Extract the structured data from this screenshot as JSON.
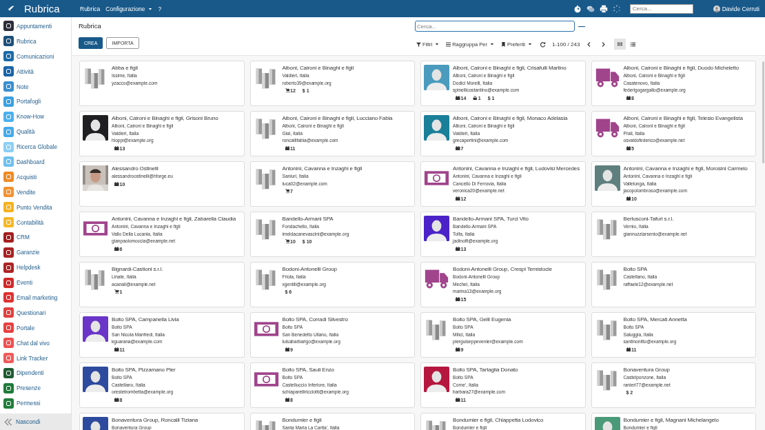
{
  "topbar": {
    "app_title": "Rubrica",
    "menu": [
      {
        "label": "Rubrica",
        "dropdown": false
      },
      {
        "label": "Configurazione",
        "dropdown": true
      },
      {
        "label": "?",
        "dropdown": false
      }
    ],
    "search": {
      "placeholder": "Cerca..."
    },
    "user": "Davide Cerruti"
  },
  "sidebar": {
    "items": [
      {
        "label": "Appuntamenti",
        "color": "#2b2d3a"
      },
      {
        "label": "Rubrica",
        "color": "#1d4f7a"
      },
      {
        "label": "Comunicazioni",
        "color": "#1a6aa8"
      },
      {
        "label": "Attività",
        "color": "#1a64a8"
      },
      {
        "label": "Note",
        "color": "#3a8fd0"
      },
      {
        "label": "Portafogli",
        "color": "#3aa0e0"
      },
      {
        "label": "Know-How",
        "color": "#4ab0ef"
      },
      {
        "label": "Qualità",
        "color": "#45aaea"
      },
      {
        "label": "Ricerca Globale",
        "color": "#8ccff5"
      },
      {
        "label": "Dashboard",
        "color": "#6fc0ef"
      },
      {
        "label": "Acquisti",
        "color": "#f08a24"
      },
      {
        "label": "Vendite",
        "color": "#f39230"
      },
      {
        "label": "Punto Vendita",
        "color": "#f6b21c"
      },
      {
        "label": "Contabilità",
        "color": "#f5b828"
      },
      {
        "label": "CRM",
        "color": "#a31e1e"
      },
      {
        "label": "Garanzie",
        "color": "#a82222"
      },
      {
        "label": "Helpdesk",
        "color": "#ad2424"
      },
      {
        "label": "Eventi",
        "color": "#d02a2a"
      },
      {
        "label": "Email marketing",
        "color": "#e03030"
      },
      {
        "label": "Questionari",
        "color": "#e04040"
      },
      {
        "label": "Portale",
        "color": "#e84040"
      },
      {
        "label": "Chat dal vivo",
        "color": "#ef5050"
      },
      {
        "label": "Link Tracker",
        "color": "#ef5a5a"
      },
      {
        "label": "Dipendenti",
        "color": "#1e5b32"
      },
      {
        "label": "Presenze",
        "color": "#1e7b3a"
      },
      {
        "label": "Permessi",
        "color": "#207d3c"
      }
    ],
    "footer": "Nascondi"
  },
  "control": {
    "breadcrumb": "Rubrica",
    "search": {
      "placeholder": "Cerca..."
    },
    "toggle": "—",
    "buttons": [
      {
        "label": "CREA",
        "kind": "primary"
      },
      {
        "label": "IMPORTA",
        "kind": "secondary"
      }
    ],
    "dropdowns": [
      {
        "kind": "filter",
        "label": "Filtri"
      },
      {
        "kind": "group",
        "label": "Raggruppa Per"
      },
      {
        "kind": "bookmark",
        "label": "Preferiti"
      }
    ],
    "pager": "1-100 / 243",
    "views": [
      {
        "kind": "kanban",
        "selected": true
      },
      {
        "kind": "list",
        "selected": false
      }
    ]
  },
  "cards": [
    {
      "kind": "building",
      "name": "Abba e figli",
      "lines": [
        "Issime, Italia",
        "yzacco@example.com"
      ]
    },
    {
      "kind": "building",
      "name": "Alboni, Caironi e Binaghi e figli",
      "lines": [
        "Valdieri, Italia",
        "roberto39@example.org"
      ],
      "stats": [
        {
          "kind": "cart",
          "count": "12"
        },
        {
          "kind": "money",
          "symbol": "$",
          "count": "1"
        }
      ]
    },
    {
      "kind": "person",
      "color": "#4a9bbd",
      "name": "Alboni, Caironi e Binaghi e figli, Crisafulli Martino",
      "lines": [
        "Alboni, Caironi e Binaghi e figli",
        "Dodici Morelli, Italia",
        "spinellicostantino@example.com"
      ],
      "stats": [
        {
          "kind": "calendar",
          "count": "14"
        },
        {
          "kind": "lock",
          "count": "1"
        },
        {
          "kind": "money",
          "symbol": "$",
          "count": "1"
        }
      ]
    },
    {
      "kind": "truck",
      "name": "Alboni, Caironi e Binaghi e figli, Duodo Micheletto",
      "lines": [
        "Alboni, Caironi e Binaghi e figli",
        "Casatenovo, Italia",
        "federigogargallo@example.org"
      ],
      "stats": [
        {
          "kind": "calendar",
          "count": "8"
        }
      ]
    },
    {
      "kind": "person",
      "color": "#1f1f22",
      "name": "Alboni, Caironi e Binaghi e figli, Grisoni Bruno",
      "lines": [
        "Alboni, Caironi e Binaghi e figli",
        "Valdieri, Italia",
        "hioppi@example.org"
      ],
      "stats": [
        {
          "kind": "calendar",
          "count": "13"
        }
      ]
    },
    {
      "kind": "building",
      "name": "Alboni, Caironi e Binaghi e figli, Lucciano Fabia",
      "lines": [
        "Alboni, Caironi e Binaghi e figli",
        "Gial, Italia",
        "roncallifabia@example.com"
      ],
      "stats": [
        {
          "kind": "calendar",
          "count": "11"
        }
      ]
    },
    {
      "kind": "person",
      "color": "#1a7f99",
      "name": "Alboni, Caironi e Binaghi e figli, Monaco Adelasia",
      "lines": [
        "Alboni, Caironi e Binaghi e figli",
        "Valdieri, Italia",
        "grecapertini@example.com"
      ],
      "stats": [
        {
          "kind": "calendar",
          "count": "7"
        }
      ]
    },
    {
      "kind": "truck",
      "name": "Alboni, Caironi e Binaghi e figli, Telesio Evangelista",
      "lines": [
        "Alboni, Caironi e Binaghi e figli",
        "Prali, Italia",
        "osvaldofederico@example.net"
      ],
      "stats": [
        {
          "kind": "calendar",
          "count": "5"
        }
      ]
    },
    {
      "kind": "picture",
      "name": "Alessandro Ostinelli",
      "lines": [
        "alessandroostinelli@hforge.eu"
      ],
      "stats": [
        {
          "kind": "calendar",
          "count": "10"
        }
      ]
    },
    {
      "kind": "building",
      "name": "Antonini, Cavanna e Inzaghi e figli",
      "lines": [
        "Sanluri, Italia",
        "luca02@example.com"
      ],
      "stats": [
        {
          "kind": "cart",
          "count": "7"
        }
      ]
    },
    {
      "kind": "banknote",
      "name": "Antonini, Cavanna e Inzaghi e figli, Ludovisi Mercedes",
      "lines": [
        "Antonini, Cavanna e Inzaghi e figli",
        "Cancello Di Ferrovia, Italia",
        "veronica20@example.net"
      ],
      "stats": [
        {
          "kind": "calendar",
          "count": "12"
        }
      ]
    },
    {
      "kind": "person",
      "color": "#5f7f7f",
      "name": "Antonini, Cavanna e Inzaghi e figli, Morosini Carmelo",
      "lines": [
        "Antonini, Cavanna e Inzaghi e figli",
        "Vallelunga, Italia",
        "jacopolombroso@example.com"
      ],
      "stats": [
        {
          "kind": "calendar",
          "count": "10"
        }
      ]
    },
    {
      "kind": "banknote",
      "name": "Antonini, Cavanna e Inzaghi e figli, Zabarella Claudia",
      "lines": [
        "Antonini, Cavanna e Inzaghi e figli",
        "Vallo Della Lucania, Italia",
        "gianpaolomoccia@example.net"
      ],
      "stats": [
        {
          "kind": "calendar",
          "count": "6"
        }
      ]
    },
    {
      "kind": "building",
      "name": "Bandello-Armani SPA",
      "lines": [
        "Fondachello, Italia",
        "imeldacanevascini@example.org"
      ],
      "stats": [
        {
          "kind": "cart",
          "count": "10"
        },
        {
          "kind": "money",
          "symbol": "$",
          "count": "10"
        }
      ]
    },
    {
      "kind": "person",
      "color": "#4b22c8",
      "name": "Bandello-Armani SPA, Turci Vito",
      "lines": [
        "Bandello-Armani SPA",
        "Tolfa, Italia",
        "jadinolfi@example.org"
      ],
      "stats": [
        {
          "kind": "calendar",
          "count": "13"
        }
      ]
    },
    {
      "kind": "building",
      "name": "Berlusconi-Tafuri s.r.l.",
      "lines": [
        "Vernio, Italia",
        "giannuzziarsenio@example.net"
      ]
    },
    {
      "kind": "building",
      "name": "Bignardi-Castioni s.r.l.",
      "lines": [
        "Linate, Italia",
        "acanali@example.net"
      ],
      "stats": [
        {
          "kind": "cart",
          "count": "1"
        }
      ]
    },
    {
      "kind": "building",
      "name": "Bodoni-Antonelli Group",
      "lines": [
        "Friola, Italia",
        "xgentili@example.org"
      ],
      "stats": [
        {
          "kind": "money",
          "symbol": "$",
          "count": "6"
        }
      ]
    },
    {
      "kind": "truck",
      "name": "Bodoni-Antonelli Group, Crespi Temistocle",
      "lines": [
        "Bodoni-Antonelli Group",
        "Mechel, Italia",
        "marina13@example.org"
      ],
      "stats": [
        {
          "kind": "calendar",
          "count": "15"
        }
      ]
    },
    {
      "kind": "building",
      "name": "Boito SPA",
      "lines": [
        "Castellano, Italia",
        "raffaele12@example.net"
      ]
    },
    {
      "kind": "person",
      "color": "#6a35c8",
      "name": "Boito SPA, Campanella Livia",
      "lines": [
        "Boito SPA",
        "San Nicola Manfredi, Italia",
        "kguarana@example.com"
      ],
      "stats": [
        {
          "kind": "calendar",
          "count": "11"
        }
      ]
    },
    {
      "kind": "banknote",
      "name": "Boito SPA, Corradi Silvestro",
      "lines": [
        "Boito SPA",
        "San Benedetto Ullano, Italia",
        "luisabarbarigo@example.org"
      ],
      "stats": [
        {
          "kind": "calendar",
          "count": "9"
        }
      ]
    },
    {
      "kind": "building",
      "name": "Boito SPA, Gelli Eugenia",
      "lines": [
        "Boito SPA",
        "Milici, Italia",
        "pierguiseppevenier@example.com"
      ],
      "stats": [
        {
          "kind": "calendar",
          "count": "9"
        }
      ]
    },
    {
      "kind": "building",
      "name": "Boito SPA, Mercati Annetta",
      "lines": [
        "Boito SPA",
        "Saluggia, Italia",
        "santinonitto@example.org"
      ],
      "stats": [
        {
          "kind": "calendar",
          "count": "11"
        }
      ]
    },
    {
      "kind": "person",
      "color": "#2e4a9e",
      "name": "Boito SPA, Pizzamano Pier",
      "lines": [
        "Boito SPA",
        "Castellano, Italia",
        "orestetrombetta@example.org"
      ],
      "stats": [
        {
          "kind": "calendar",
          "count": "8"
        }
      ]
    },
    {
      "kind": "banknote",
      "name": "Boito SPA, Sauli Enzo",
      "lines": [
        "Boito SPA",
        "Castelluccio Inferiore, Italia",
        "schiaparelliricciotti@example.org"
      ],
      "stats": [
        {
          "kind": "calendar",
          "count": "8"
        }
      ]
    },
    {
      "kind": "person",
      "color": "#b5173e",
      "name": "Boito SPA, Tartaglia Donato",
      "lines": [
        "Boito SPA",
        "Corne', Italia",
        "barbara27@example.com"
      ],
      "stats": [
        {
          "kind": "calendar",
          "count": "11"
        }
      ]
    },
    {
      "kind": "building",
      "name": "Bonaventura Group",
      "lines": [
        "Castelponzone, Italia",
        "ranieri77@example.net"
      ],
      "stats": [
        {
          "kind": "money",
          "symbol": "$",
          "count": "2"
        }
      ]
    },
    {
      "kind": "person",
      "color": "#2e4a9e",
      "name": "Bonaventura Group, Roncalli Tiziana",
      "lines": [
        "Bonaventura Group"
      ]
    },
    {
      "kind": "building",
      "name": "Bondumier e figli",
      "lines": [
        "Santa Maria La Carita', Italia"
      ]
    },
    {
      "kind": "building",
      "name": "Bondumier e figli, Chiappetta Lodovico",
      "lines": [
        "Bondumier e figli"
      ]
    },
    {
      "kind": "person",
      "color": "#4a9a7a",
      "name": "Bondumier e figli, Magnani Michelangelo",
      "lines": [
        "Bondumier e figli"
      ]
    }
  ]
}
